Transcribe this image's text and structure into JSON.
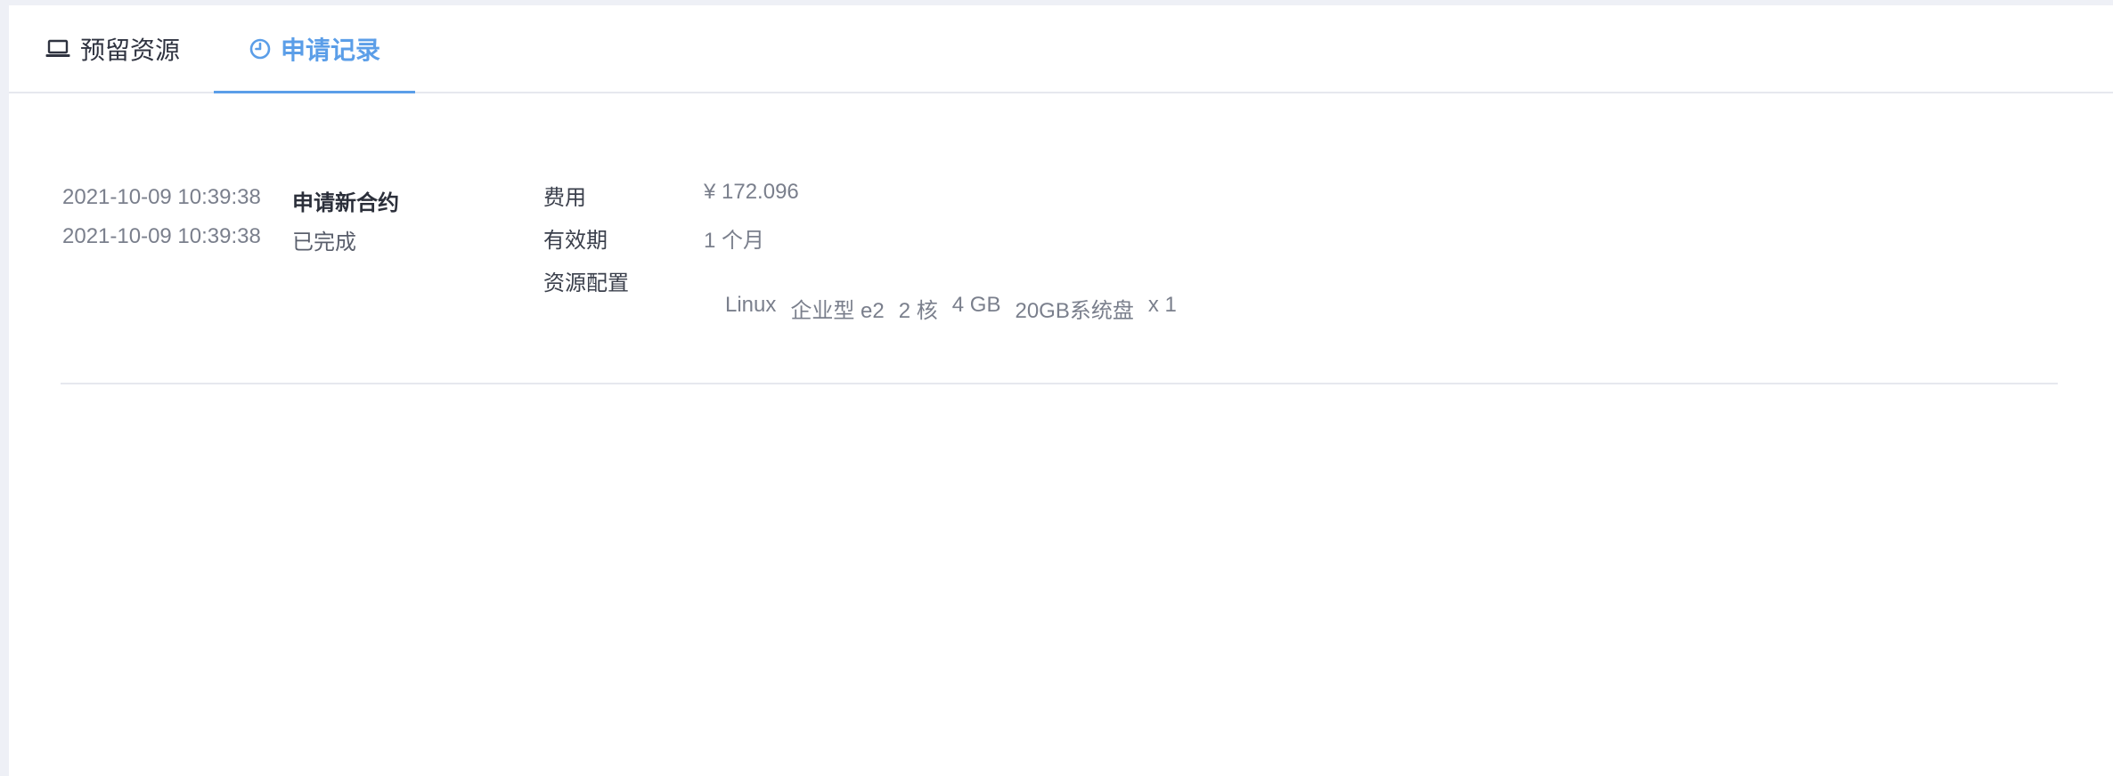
{
  "tabs": [
    {
      "label": "预留资源",
      "icon": "laptop-icon",
      "active": false
    },
    {
      "label": "申请记录",
      "icon": "clock-icon",
      "active": true
    }
  ],
  "record": {
    "log": [
      {
        "time": "2021-10-09 10:39:38",
        "status": "申请新合约"
      },
      {
        "time": "2021-10-09 10:39:38",
        "status": "已完成"
      }
    ],
    "fields": {
      "fee_label": "费用",
      "fee_value": "¥ 172.096",
      "validity_label": "有效期",
      "validity_value": "1 个月",
      "config_label": "资源配置"
    },
    "spec": {
      "os": "Linux",
      "type": "企业型 e2",
      "cpu": "2 核",
      "memory": "4 GB",
      "disk": "20GB系统盘",
      "quantity": "x 1"
    }
  },
  "colors": {
    "accent": "#5b9ee8",
    "background": "#eef0f6",
    "panel": "#ffffff",
    "divider": "#e6e8ee"
  }
}
